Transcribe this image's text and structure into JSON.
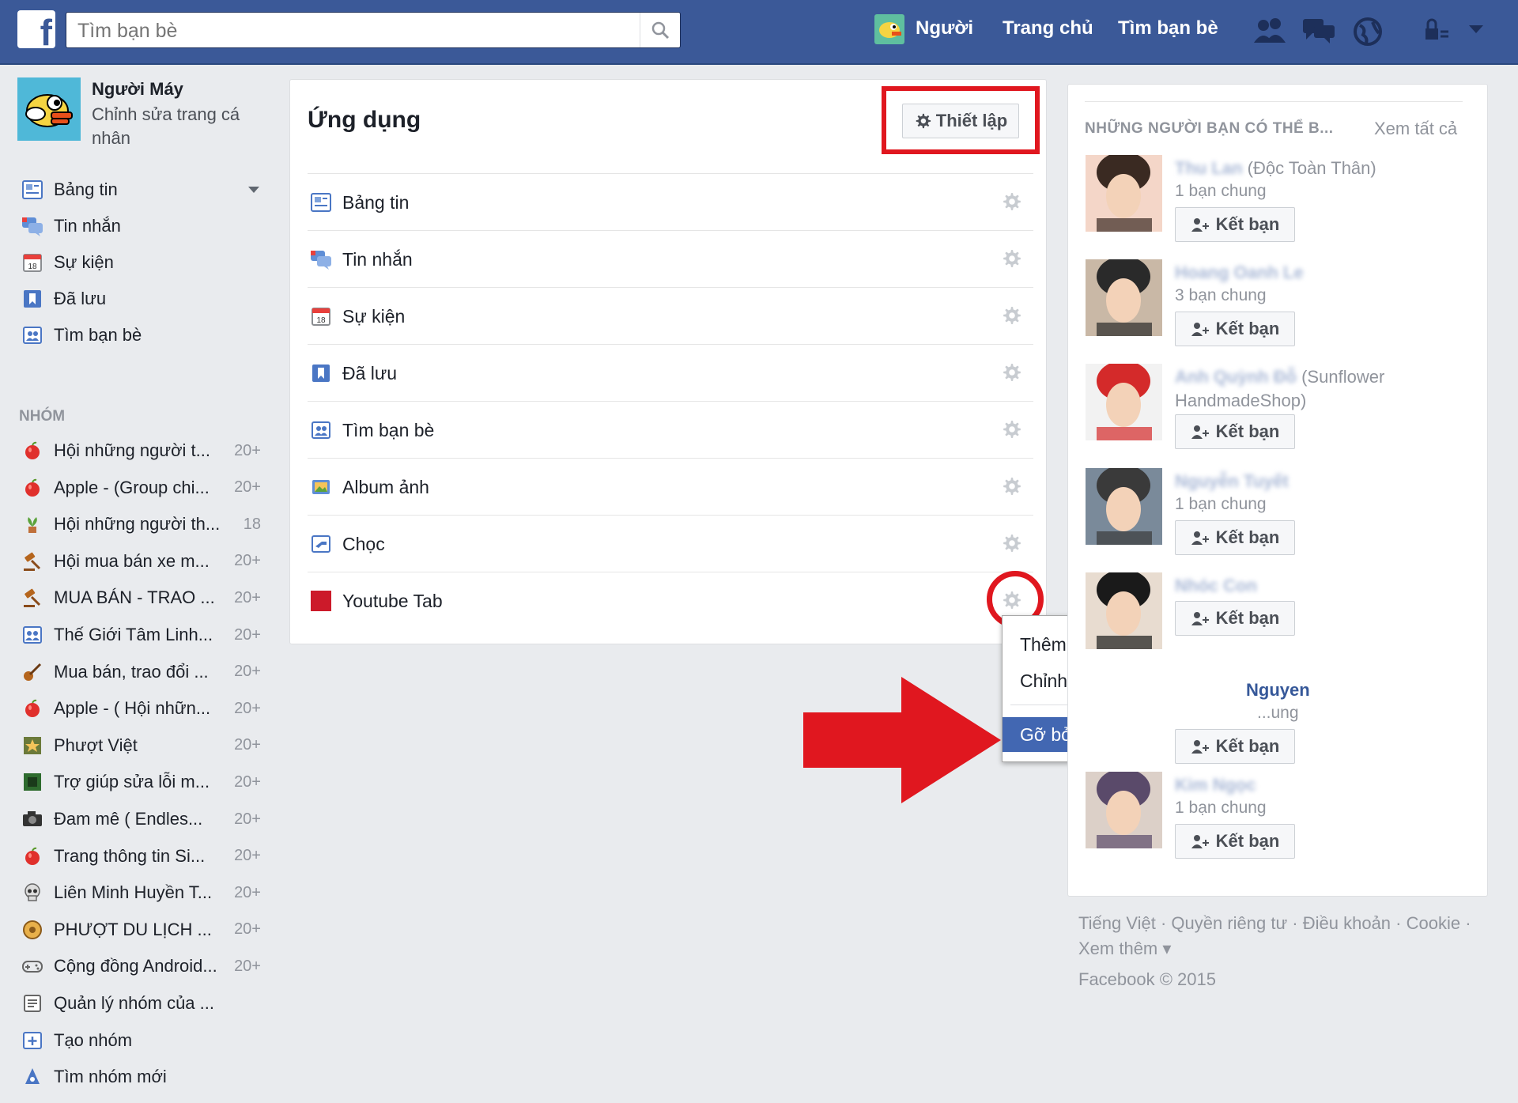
{
  "topbar": {
    "search_placeholder": "Tìm bạn bè",
    "profile_link": "Người",
    "home_link": "Trang chủ",
    "find_friends_link": "Tìm bạn bè"
  },
  "profile": {
    "name": "Người Máy",
    "edit_label": "Chỉnh sửa trang cá nhân"
  },
  "left_nav": [
    {
      "label": "Bảng tin",
      "icon": "news-feed-icon"
    },
    {
      "label": "Tin nhắn",
      "icon": "messages-icon"
    },
    {
      "label": "Sự kiện",
      "icon": "events-icon"
    },
    {
      "label": "Đã lưu",
      "icon": "saved-icon"
    },
    {
      "label": "Tìm bạn bè",
      "icon": "find-friends-icon"
    }
  ],
  "groups": {
    "header": "NHÓM",
    "items": [
      {
        "label": "Hội những người t...",
        "count": "20+"
      },
      {
        "label": "Apple - (Group chi...",
        "count": "20+"
      },
      {
        "label": "Hội những người th...",
        "count": "18"
      },
      {
        "label": "Hội mua bán xe m...",
        "count": "20+"
      },
      {
        "label": "MUA BÁN - TRAO ...",
        "count": "20+"
      },
      {
        "label": "Thế Giới Tâm Linh...",
        "count": "20+"
      },
      {
        "label": "Mua bán, trao đổi ...",
        "count": "20+"
      },
      {
        "label": "Apple - ( Hội nhữn...",
        "count": "20+"
      },
      {
        "label": "Phượt Việt",
        "count": "20+"
      },
      {
        "label": "Trợ giúp sửa lỗi m...",
        "count": "20+"
      },
      {
        "label": "Đam mê ( Endles...",
        "count": "20+"
      },
      {
        "label": "Trang thông tin Si...",
        "count": "20+"
      },
      {
        "label": "Liên Minh Huyền T...",
        "count": "20+"
      },
      {
        "label": "PHƯỢT DU LỊCH ...",
        "count": "20+"
      },
      {
        "label": "Cộng đồng Android...",
        "count": "20+"
      },
      {
        "label": "Quản lý nhóm của ...",
        "count": ""
      },
      {
        "label": "Tạo nhóm",
        "count": ""
      },
      {
        "label": "Tìm nhóm mới",
        "count": ""
      }
    ]
  },
  "apps_panel": {
    "title": "Ứng dụng",
    "settings_label": "Thiết lập",
    "apps": [
      {
        "label": "Bảng tin",
        "icon": "news-feed-icon"
      },
      {
        "label": "Tin nhắn",
        "icon": "messages-icon"
      },
      {
        "label": "Sự kiện",
        "icon": "events-icon"
      },
      {
        "label": "Đã lưu",
        "icon": "saved-icon"
      },
      {
        "label": "Tìm bạn bè",
        "icon": "find-friends-icon"
      },
      {
        "label": "Album ảnh",
        "icon": "photos-icon"
      },
      {
        "label": "Chọc",
        "icon": "poke-icon"
      },
      {
        "label": "Youtube Tab",
        "icon": "youtube-tab-icon"
      }
    ]
  },
  "dropdown": {
    "add_favorite": "Thêm vào mục yêu thích",
    "edit_settings": "Chỉnh sửa thiết lập",
    "remove_app": "Gỡ bỏ ứng dụng"
  },
  "pymk": {
    "header": "NHỮNG NGƯỜI BẠN CÓ THỂ B...",
    "see_all": "Xem tất cả",
    "add_label": "Kết bạn",
    "people": [
      {
        "name": "Thu Lan",
        "extra": "(Độc Toàn Thân)",
        "mutual": "1 bạn chung"
      },
      {
        "name": "Hoang Oanh Le",
        "extra": "",
        "mutual": "3 bạn chung"
      },
      {
        "name": "Anh Quỳnh Đỗ",
        "extra": "(Sunflower HandmadeShop)",
        "mutual": ""
      },
      {
        "name": "Nguyễn Tuyết",
        "extra": "",
        "mutual": "1 bạn chung"
      },
      {
        "name": "Nhóc Con",
        "extra": "",
        "mutual": ""
      },
      {
        "name": "Nguyen",
        "extra": "",
        "mutual": "...ung"
      },
      {
        "name": "Kim Ngọc",
        "extra": "",
        "mutual": "1 bạn chung"
      }
    ]
  },
  "footer": {
    "links": "Tiếng Việt · Quyền riêng tư · Điều khoản · Cookie · Xem thêm ▾",
    "copyright": "Facebook © 2015"
  },
  "colors": {
    "brand": "#3b5998",
    "highlight_red": "#e0171f",
    "menu_active": "#4267b2"
  }
}
